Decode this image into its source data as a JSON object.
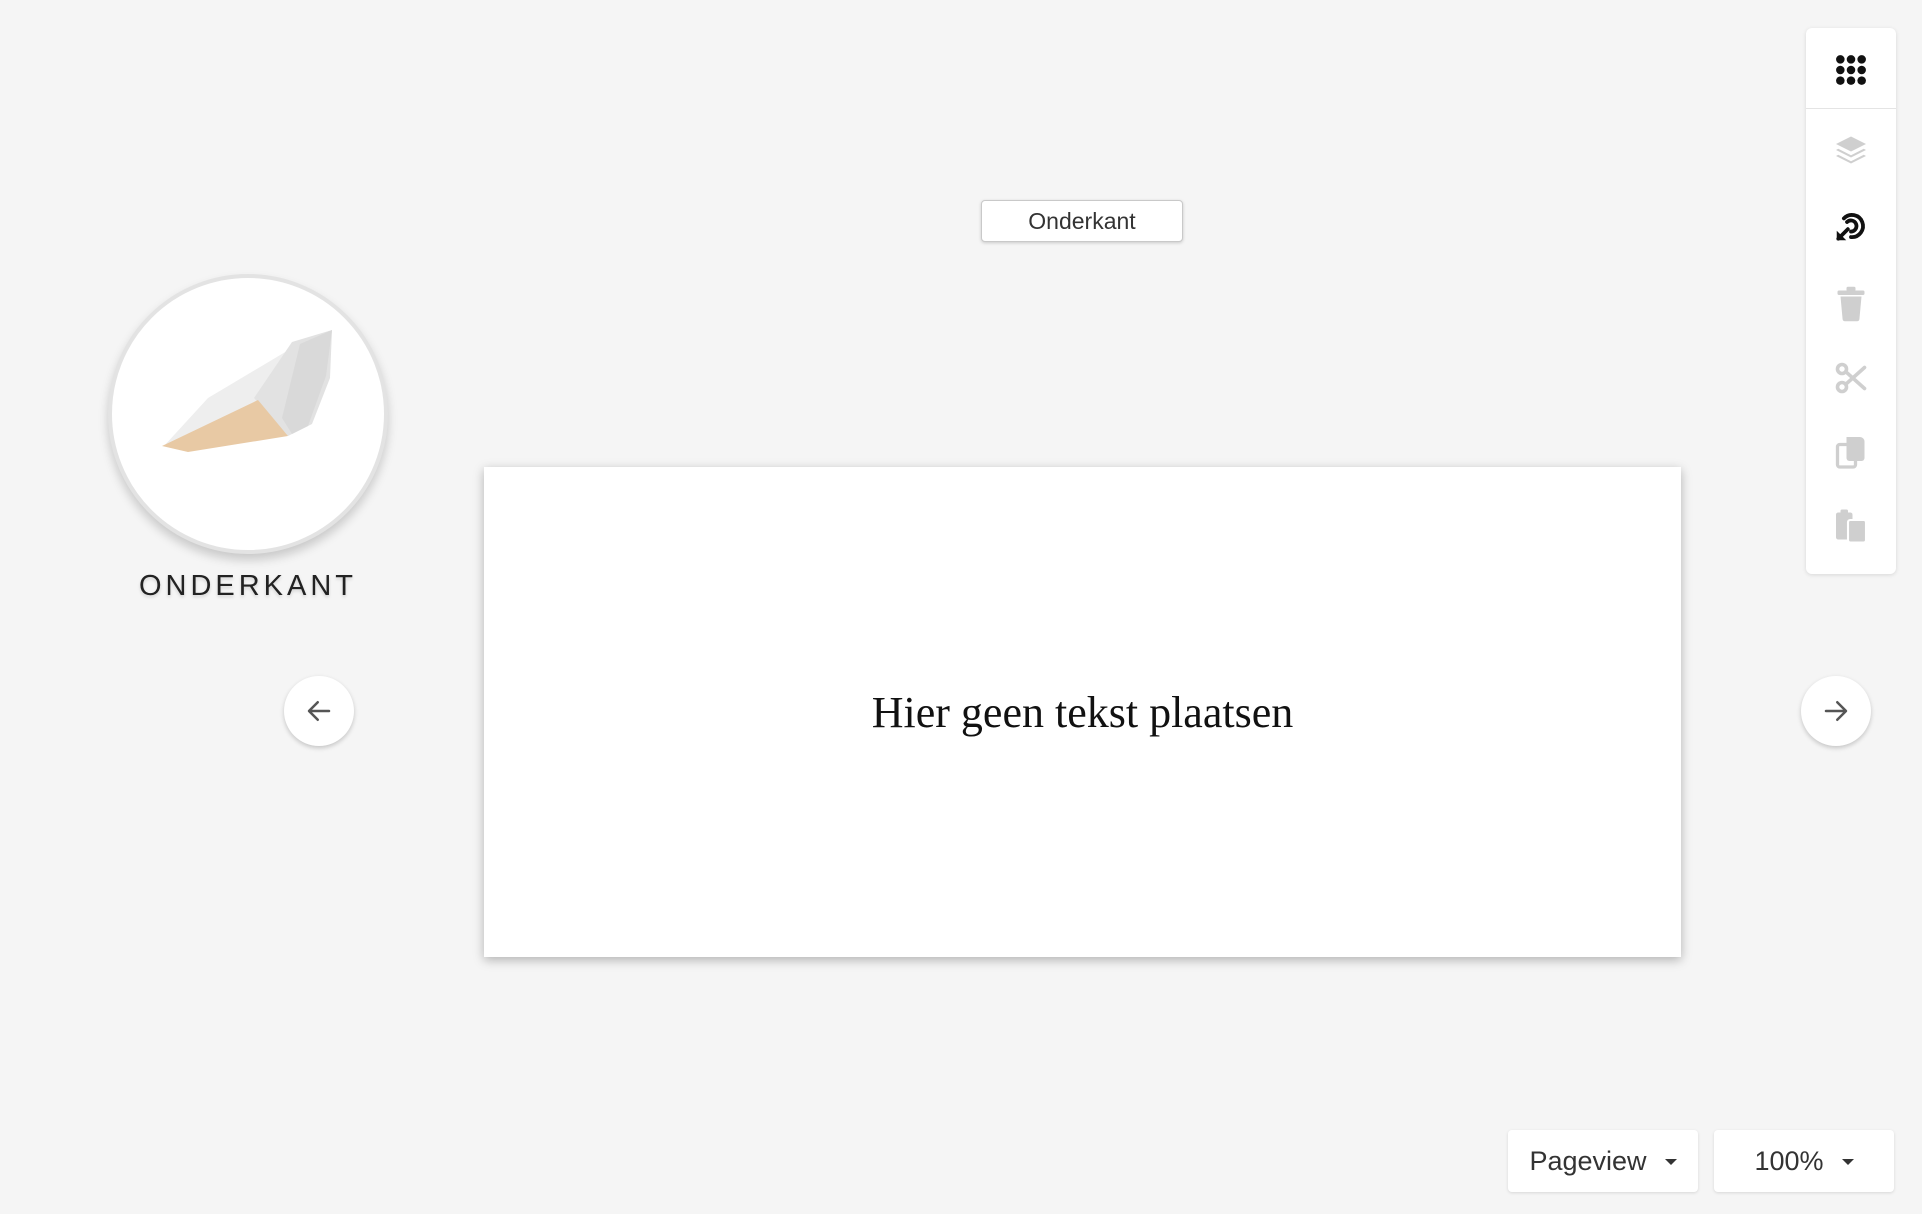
{
  "side_label": "Onderkant",
  "preview": {
    "caption": "ONDERKANT",
    "flap_color": "#e8c9a4"
  },
  "canvas": {
    "text": "Hier geen tekst plaatsen"
  },
  "toolbar": {
    "items": [
      {
        "name": "apps-grid-icon",
        "enabled": true
      },
      {
        "name": "layers-icon",
        "enabled": false
      },
      {
        "name": "rotate-icon",
        "enabled": true
      },
      {
        "name": "trash-icon",
        "enabled": false
      },
      {
        "name": "cut-icon",
        "enabled": false
      },
      {
        "name": "copy-icon",
        "enabled": false
      },
      {
        "name": "paste-icon",
        "enabled": false
      }
    ],
    "active_color": "#111111",
    "disabled_color": "#cfcfcf"
  },
  "view_dropdown": {
    "selected": "Pageview"
  },
  "zoom_dropdown": {
    "selected": "100%"
  }
}
